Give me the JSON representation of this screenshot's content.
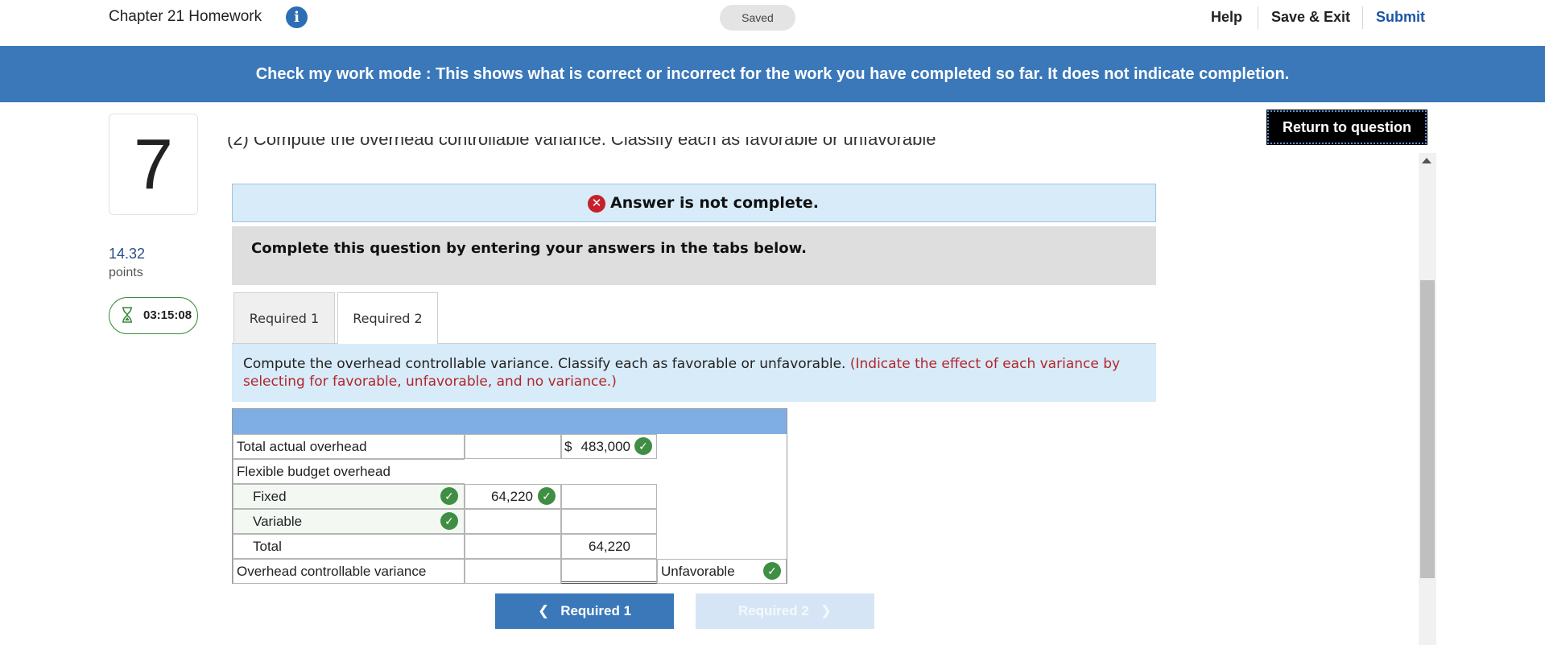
{
  "header": {
    "title": "Chapter 21 Homework",
    "status": "Saved",
    "help": "Help",
    "save_exit": "Save & Exit",
    "submit": "Submit"
  },
  "banner": "Check my work mode : This shows what is correct or incorrect for the work you have completed so far. It does not indicate completion.",
  "question": {
    "number": "7",
    "points_value": "14.32",
    "points_label": "points",
    "timer": "03:15:08",
    "clipped_prompt": "(2) Compute the overhead controllable variance. Classify each as favorable or unfavorable."
  },
  "return_button": "Return to question",
  "answer_status": "Answer is not complete.",
  "instructions": "Complete this question by entering your answers in the tabs below.",
  "tabs": [
    {
      "label": "Required 1",
      "active": false
    },
    {
      "label": "Required 2",
      "active": true
    }
  ],
  "prompt": {
    "text": "Compute the overhead controllable variance. Classify each as favorable or unfavorable.",
    "note": "(Indicate the effect of each variance by selecting for favorable, unfavorable, and no variance.)"
  },
  "table": {
    "rows": [
      {
        "label": "Total actual overhead",
        "col1": "",
        "col2": "483,000",
        "col2_prefix": "$",
        "col3": ""
      },
      {
        "label": "Flexible budget overhead",
        "col1": "",
        "col2": "",
        "col3": ""
      },
      {
        "label": "Fixed",
        "col1": "64,220",
        "col2": "",
        "col3": ""
      },
      {
        "label": "Variable",
        "col1": "",
        "col2": "",
        "col3": ""
      },
      {
        "label": "Total",
        "col1": "",
        "col2": "64,220",
        "col3": ""
      },
      {
        "label": "Overhead controllable variance",
        "col1": "",
        "col2": "",
        "col3": "Unfavorable"
      }
    ]
  },
  "nav": {
    "prev": "Required 1",
    "next": "Required 2"
  },
  "colors": {
    "banner": "#3a78ba",
    "submit_link": "#1c55a5",
    "correct_check": "#3f8e44",
    "error_x": "#c6202d",
    "note_red": "#b3262b"
  },
  "icons": [
    "info-icon",
    "hourglass-icon",
    "error-x-icon",
    "check-icon",
    "chevron-left-icon",
    "chevron-right-icon",
    "scroll-up-arrow-icon"
  ]
}
